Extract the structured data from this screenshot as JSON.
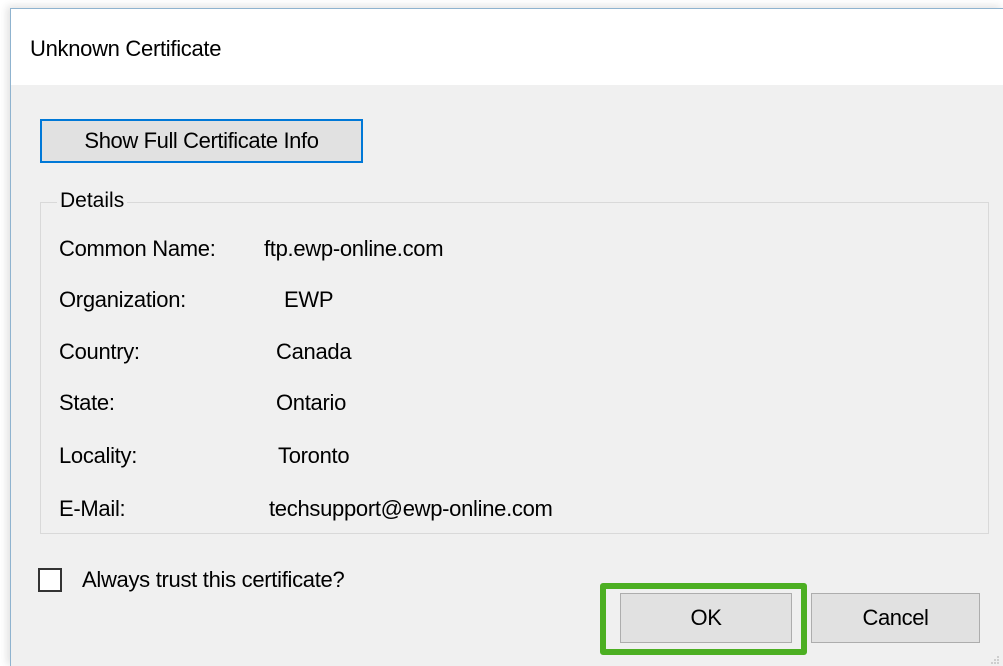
{
  "window": {
    "title": "Unknown Certificate"
  },
  "buttons": {
    "show_cert_info": "Show Full Certificate Info",
    "ok": "OK",
    "cancel": "Cancel"
  },
  "details": {
    "legend": "Details",
    "rows": [
      {
        "label": "Common Name:",
        "value": "ftp.ewp-online.com"
      },
      {
        "label": "Organization:",
        "value": "EWP"
      },
      {
        "label": "Country:",
        "value": "Canada"
      },
      {
        "label": "State:",
        "value": "Ontario"
      },
      {
        "label": "Locality:",
        "value": "Toronto"
      },
      {
        "label": "E-Mail:",
        "value": "techsupport@ewp-online.com"
      }
    ]
  },
  "trust_checkbox": {
    "label": "Always trust this certificate?",
    "checked": false
  },
  "colors": {
    "focus_border": "#0078d7",
    "highlight": "#4caf22",
    "dialog_bg": "#f0f0f0",
    "button_bg": "#e1e1e1"
  },
  "icons": {
    "resize_grip": "resize-grip-icon"
  }
}
